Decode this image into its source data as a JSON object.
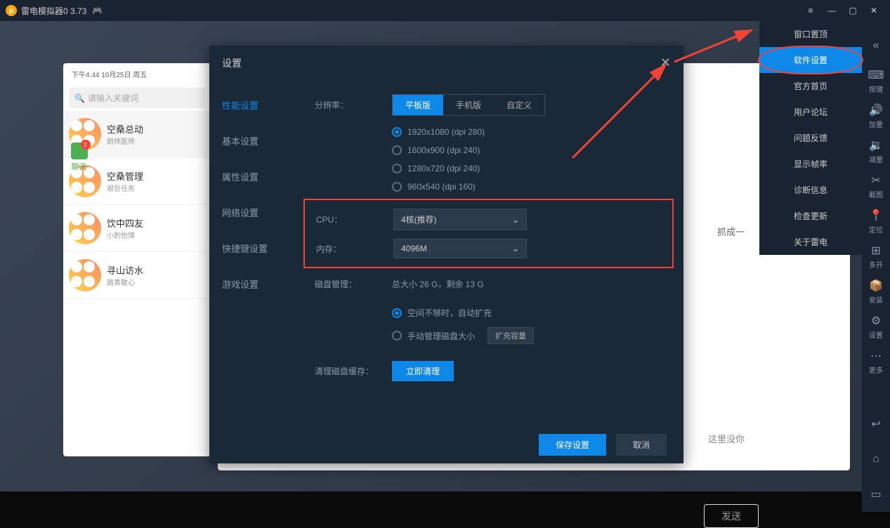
{
  "titlebar": {
    "title": "雷电模拟器0 3.73"
  },
  "toolbar": {
    "items": [
      {
        "icon": "⌨",
        "label": "按键"
      },
      {
        "icon": "🔊",
        "label": "加量"
      },
      {
        "icon": "🔉",
        "label": "减量"
      },
      {
        "icon": "✂",
        "label": "截图"
      },
      {
        "icon": "📍",
        "label": "定位"
      },
      {
        "icon": "⊞",
        "label": "多开"
      },
      {
        "icon": "📦",
        "label": "安装"
      },
      {
        "icon": "⚙",
        "label": "设置"
      },
      {
        "icon": "⋯",
        "label": "更多"
      }
    ]
  },
  "dropdown": {
    "items": [
      "窗口置顶",
      "软件设置",
      "官方首页",
      "用户论坛",
      "问题反馈",
      "显示帧率",
      "诊断信息",
      "检查更新",
      "关于雷电"
    ],
    "highlighted": 1
  },
  "chat": {
    "time": "下午4:44  10月25日 周五",
    "search_placeholder": "请输入关键词",
    "tab_label": "聊天",
    "badge": "2",
    "items": [
      {
        "name": "空桑总动",
        "desc": "厨师医师"
      },
      {
        "name": "空桑管理",
        "desc": "艰巨任务"
      },
      {
        "name": "饮中四友",
        "desc": "小酌怡情"
      },
      {
        "name": "寻山访水",
        "desc": "踏青散心"
      }
    ]
  },
  "main": {
    "grab": "抓成一",
    "msg": "这里没你",
    "send": "发送"
  },
  "settings": {
    "title": "设置",
    "sidebar": [
      "性能设置",
      "基本设置",
      "属性设置",
      "网络设置",
      "快捷键设置",
      "游戏设置"
    ],
    "labels": {
      "resolution": "分辨率：",
      "cpu": "CPU：",
      "memory": "内存：",
      "disk": "磁盘管理：",
      "clear": "清理磁盘缓存："
    },
    "res_tabs": [
      "平板版",
      "手机版",
      "自定义"
    ],
    "resolutions": [
      "1920x1080  (dpi 280)",
      "1600x900  (dpi 240)",
      "1280x720  (dpi 240)",
      "960x540  (dpi 160)"
    ],
    "cpu_value": "4核(推荐)",
    "mem_value": "4096M",
    "disk_info": "总大小 26 G，剩余 13 G",
    "disk_auto": "空间不够时，自动扩充",
    "disk_manual": "手动管理磁盘大小",
    "expand": "扩充容量",
    "clear_btn": "立即清理",
    "save": "保存设置",
    "cancel": "取消"
  }
}
